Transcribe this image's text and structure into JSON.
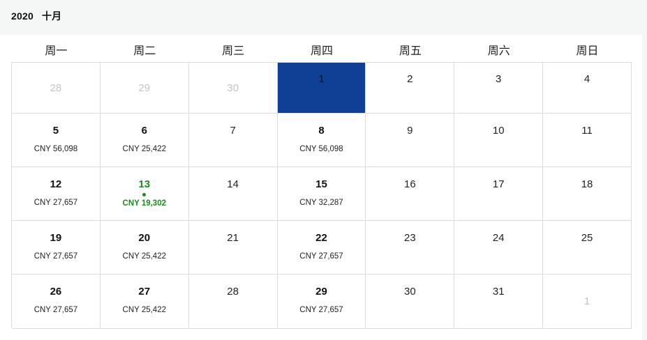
{
  "header": {
    "year": "2020",
    "month": "十月"
  },
  "weekdays": [
    "周一",
    "周二",
    "周三",
    "周四",
    "周五",
    "周六",
    "周日"
  ],
  "colors": {
    "selected": "#103f96",
    "highlight": "#1a8c1a",
    "muted": "#c4c4c4"
  },
  "calendar": {
    "weeks": [
      [
        {
          "day": "28",
          "state": "muted"
        },
        {
          "day": "29",
          "state": "muted"
        },
        {
          "day": "30",
          "state": "muted"
        },
        {
          "day": "1",
          "state": "selected"
        },
        {
          "day": "2"
        },
        {
          "day": "3"
        },
        {
          "day": "4"
        }
      ],
      [
        {
          "day": "5",
          "price": "CNY 56,098"
        },
        {
          "day": "6",
          "price": "CNY 25,422"
        },
        {
          "day": "7"
        },
        {
          "day": "8",
          "price": "CNY 56,098"
        },
        {
          "day": "9"
        },
        {
          "day": "10"
        },
        {
          "day": "11"
        }
      ],
      [
        {
          "day": "12",
          "price": "CNY 27,657"
        },
        {
          "day": "13",
          "price": "CNY 19,302",
          "state": "highlight"
        },
        {
          "day": "14"
        },
        {
          "day": "15",
          "price": "CNY 32,287"
        },
        {
          "day": "16"
        },
        {
          "day": "17"
        },
        {
          "day": "18"
        }
      ],
      [
        {
          "day": "19",
          "price": "CNY 27,657"
        },
        {
          "day": "20",
          "price": "CNY 25,422"
        },
        {
          "day": "21"
        },
        {
          "day": "22",
          "price": "CNY 27,657"
        },
        {
          "day": "23"
        },
        {
          "day": "24"
        },
        {
          "day": "25"
        }
      ],
      [
        {
          "day": "26",
          "price": "CNY 27,657"
        },
        {
          "day": "27",
          "price": "CNY 25,422"
        },
        {
          "day": "28"
        },
        {
          "day": "29",
          "price": "CNY 27,657"
        },
        {
          "day": "30"
        },
        {
          "day": "31"
        },
        {
          "day": "1",
          "state": "muted-bottom"
        }
      ]
    ]
  }
}
